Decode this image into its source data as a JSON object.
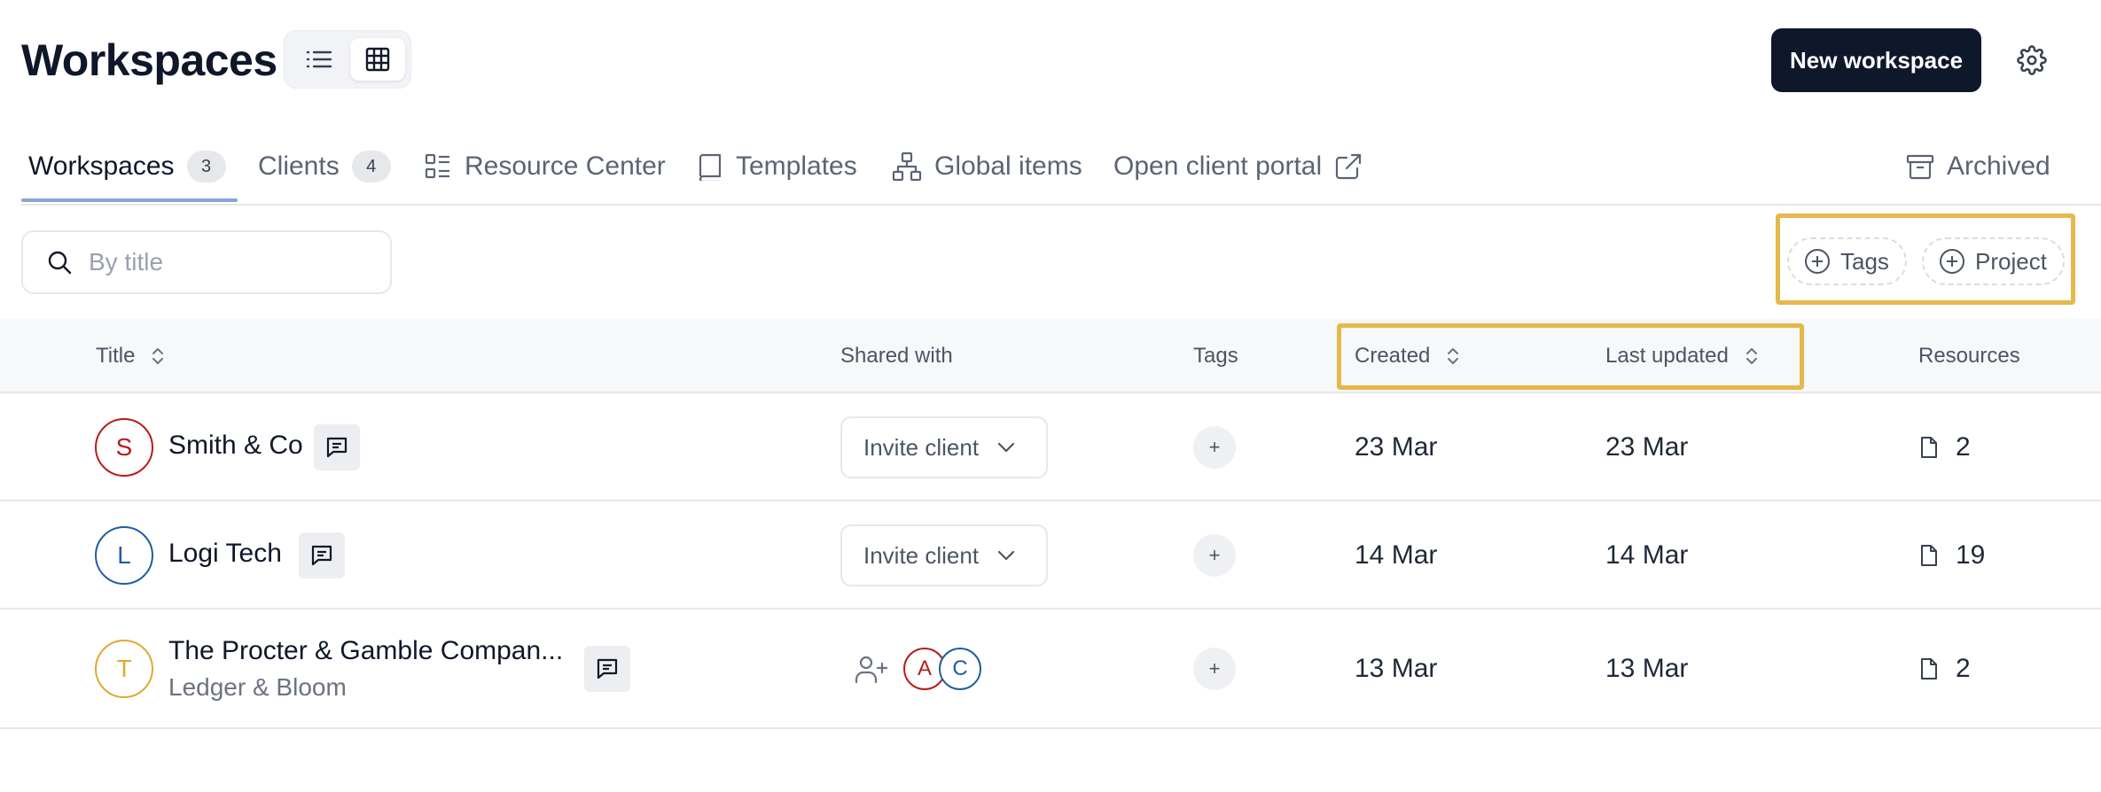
{
  "header": {
    "title": "Workspaces",
    "new_button": "New workspace"
  },
  "tabs": [
    {
      "label": "Workspaces",
      "count": "3",
      "icon": "none",
      "active": true
    },
    {
      "label": "Clients",
      "count": "4",
      "icon": "none"
    },
    {
      "label": "Resource Center",
      "icon": "list-layout-icon"
    },
    {
      "label": "Templates",
      "icon": "book-icon"
    },
    {
      "label": "Global items",
      "icon": "hierarchy-icon"
    },
    {
      "label": "Open client portal",
      "icon": "external-link-icon"
    },
    {
      "label": "Archived",
      "icon": "archive-box-icon"
    }
  ],
  "search": {
    "placeholder": "By title",
    "value": ""
  },
  "filters": [
    {
      "label": "Tags",
      "icon": "plus-circle-icon"
    },
    {
      "label": "Project",
      "icon": "plus-circle-icon"
    }
  ],
  "table": {
    "columns": [
      "Title",
      "Shared with",
      "Tags",
      "Created",
      "Last updated",
      "Resources"
    ],
    "rows": [
      {
        "initial": "S",
        "initial_color": "#b91c1c",
        "title": "Smith & Co",
        "subtitle": "",
        "shared": "Invite client",
        "tags": "+",
        "created": "23 Mar",
        "updated": "23 Mar",
        "resources": "2"
      },
      {
        "initial": "L",
        "initial_color": "#1e5fa0",
        "title": "Logi Tech",
        "subtitle": "",
        "shared": "Invite client",
        "tags": "+",
        "created": "14 Mar",
        "updated": "14 Mar",
        "resources": "19"
      },
      {
        "initial": "T",
        "initial_color": "#e0a92e",
        "title": "The Procter & Gamble Compan...",
        "subtitle": "Ledger & Bloom",
        "shared_avatars": [
          {
            "initial": "A",
            "color": "#b91c1c"
          },
          {
            "initial": "C",
            "color": "#1e5fa0"
          }
        ],
        "tags": "+",
        "created": "13 Mar",
        "updated": "13 Mar",
        "resources": "2"
      }
    ]
  },
  "colors": {
    "primary": "#0f172a",
    "highlight": "#e6b84a",
    "tab_underline": "#8aa4d8"
  }
}
